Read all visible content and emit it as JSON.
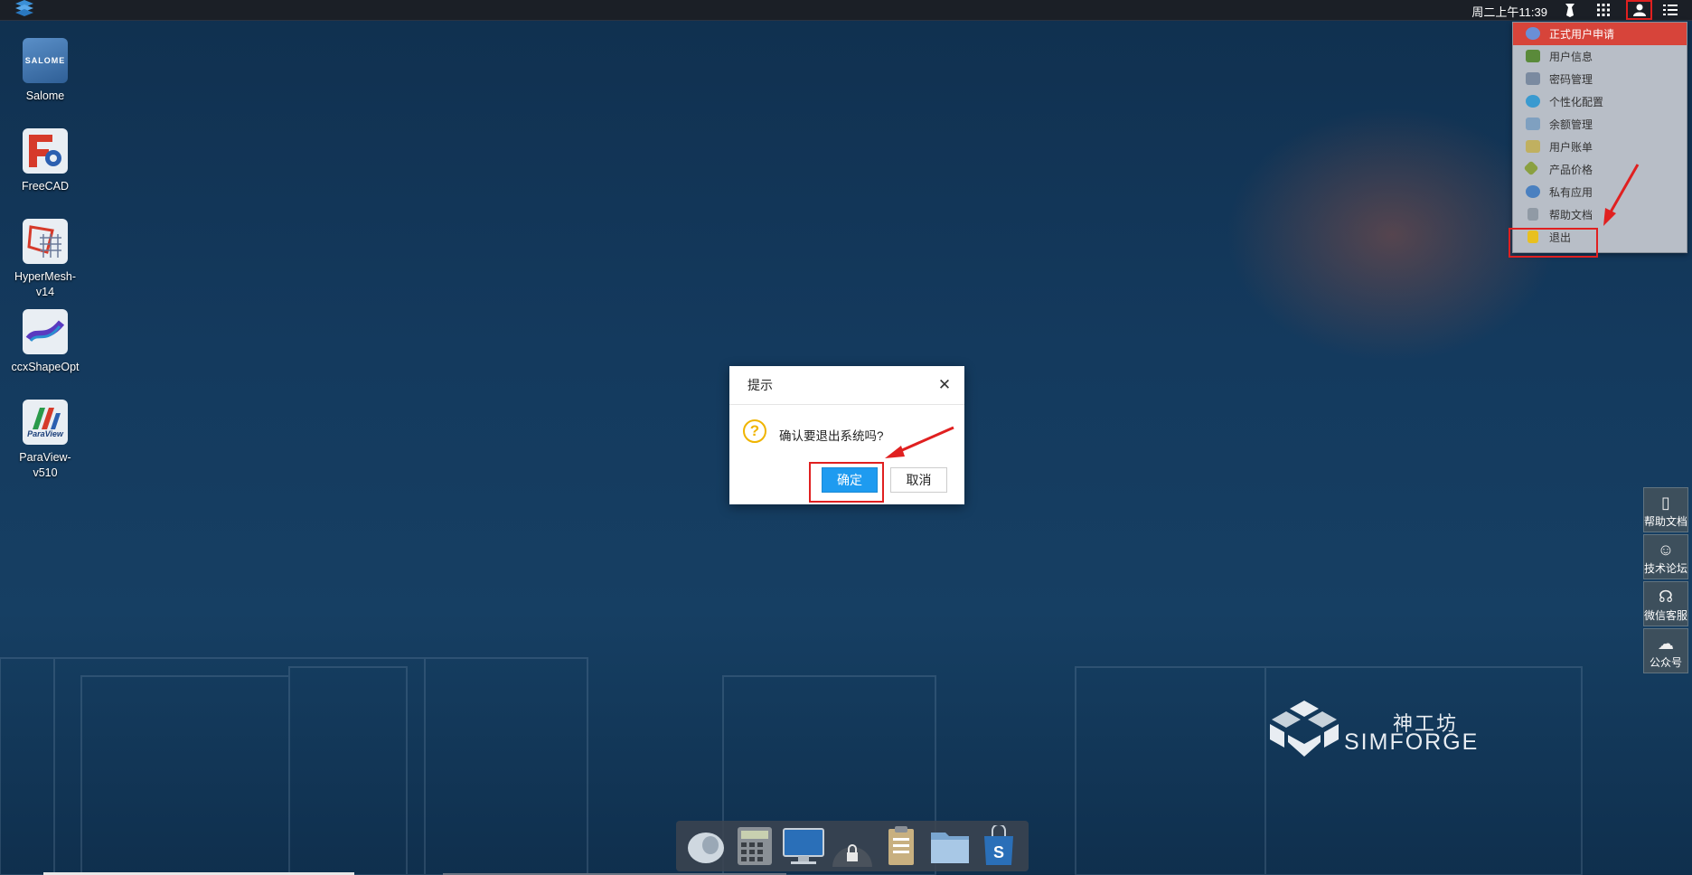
{
  "topbar": {
    "clock": "周二上午11:39",
    "icons": [
      "logo-icon",
      "tie-icon",
      "grid-icon",
      "user-icon",
      "menu-icon"
    ]
  },
  "desktop": {
    "icons": [
      {
        "label": "Salome",
        "icon": "salome-icon",
        "brand_text": "SALOME"
      },
      {
        "label": "FreeCAD",
        "icon": "freecad-icon"
      },
      {
        "label": "HyperMesh-v14",
        "icon": "hypermesh-icon"
      },
      {
        "label": "ccxShapeOpt",
        "icon": "ccxshapeopt-icon"
      },
      {
        "label": "ParaView-v510",
        "icon": "paraview-icon",
        "brand_text": "ParaView"
      }
    ]
  },
  "user_menu": {
    "items": [
      {
        "label": "正式用户申请",
        "icon": "user-apply-icon",
        "color": "#6a8fd6",
        "active": true
      },
      {
        "label": "用户信息",
        "icon": "user-info-icon",
        "color": "#5a8a3a"
      },
      {
        "label": "密码管理",
        "icon": "password-icon",
        "color": "#7a8aa0"
      },
      {
        "label": "个性化配置",
        "icon": "settings-icon",
        "color": "#3a9ad0"
      },
      {
        "label": "余额管理",
        "icon": "balance-icon",
        "color": "#7fa0c0"
      },
      {
        "label": "用户账单",
        "icon": "bill-icon",
        "color": "#c0b060"
      },
      {
        "label": "产品价格",
        "icon": "price-icon",
        "color": "#8aa040"
      },
      {
        "label": "私有应用",
        "icon": "private-app-icon",
        "color": "#4a80c0"
      },
      {
        "label": "帮助文档",
        "icon": "help-doc-icon",
        "color": "#909aa5"
      },
      {
        "label": "退出",
        "icon": "logout-icon",
        "color": "#e8c020"
      }
    ]
  },
  "dialog": {
    "title": "提示",
    "message": "确认要退出系统吗?",
    "ok_label": "确定",
    "cancel_label": "取消"
  },
  "side_panel": {
    "items": [
      {
        "label": "帮助文档",
        "icon": "document-icon"
      },
      {
        "label": "技术论坛",
        "icon": "forum-icon"
      },
      {
        "label": "微信客服",
        "icon": "headset-icon"
      },
      {
        "label": "公众号",
        "icon": "wechat-icon"
      }
    ]
  },
  "brand": {
    "cn": "神工坊",
    "en": "SIMFORGE"
  },
  "dock": {
    "items": [
      "shell-icon",
      "calculator-icon",
      "monitor-icon",
      "lock-icon",
      "clipboard-icon",
      "folder-icon",
      "store-icon"
    ]
  },
  "colors": {
    "accent_red": "#e02020",
    "ok_blue": "#1e9bf0",
    "menu_active": "#d7443a"
  }
}
